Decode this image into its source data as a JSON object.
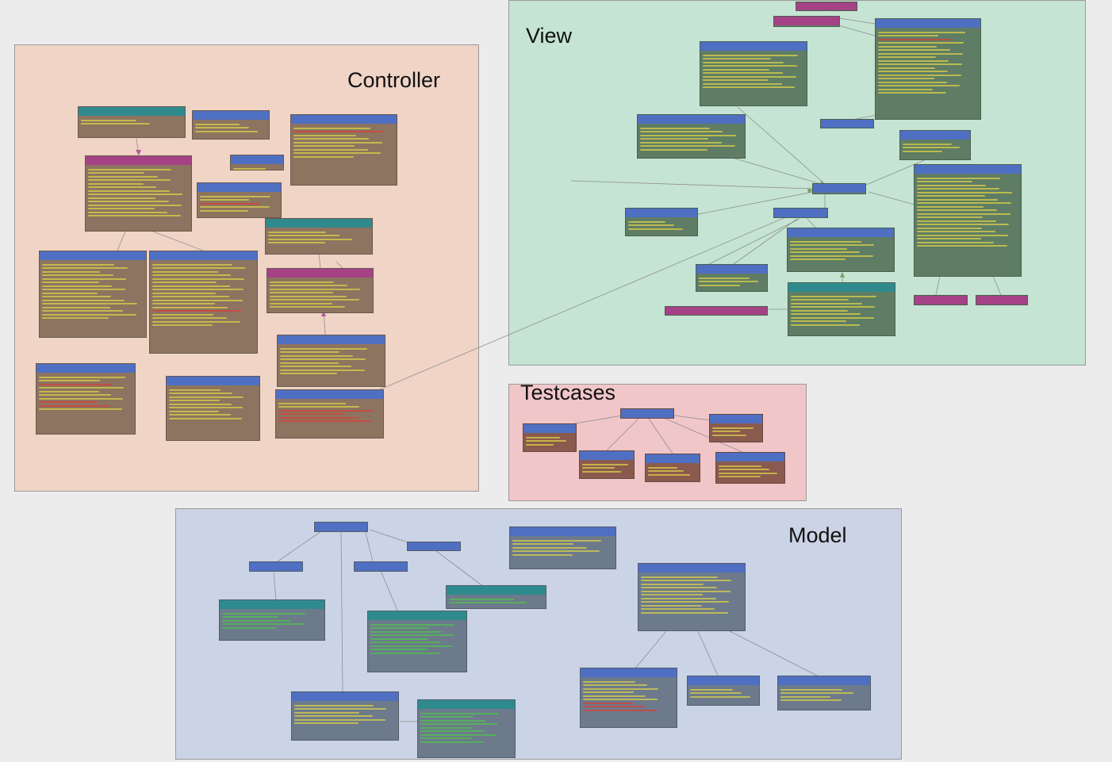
{
  "packages": {
    "controller": {
      "title": "Controller"
    },
    "view": {
      "title": "View"
    },
    "testcases": {
      "title": "Testcases"
    },
    "model": {
      "title": "Model"
    }
  },
  "colors": {
    "controller_bg": "#f0d4c6",
    "view_bg": "#c5e4d3",
    "testcases_bg": "#f1c6c8",
    "model_bg": "#cbd3e6",
    "class_header": "#4f6fc2",
    "protocol_header": "#a54286",
    "extension_header": "#2f8a8e",
    "class_body": "#8c7460",
    "view_class_body": "#5f7d64",
    "test_class_body": "#8a5a4e",
    "model_class_body": "#6c7a8c",
    "member_yellow": "#d8cf4a",
    "member_red": "#d8403a",
    "member_green": "#4fc04e",
    "link": "#8f8f8f"
  }
}
